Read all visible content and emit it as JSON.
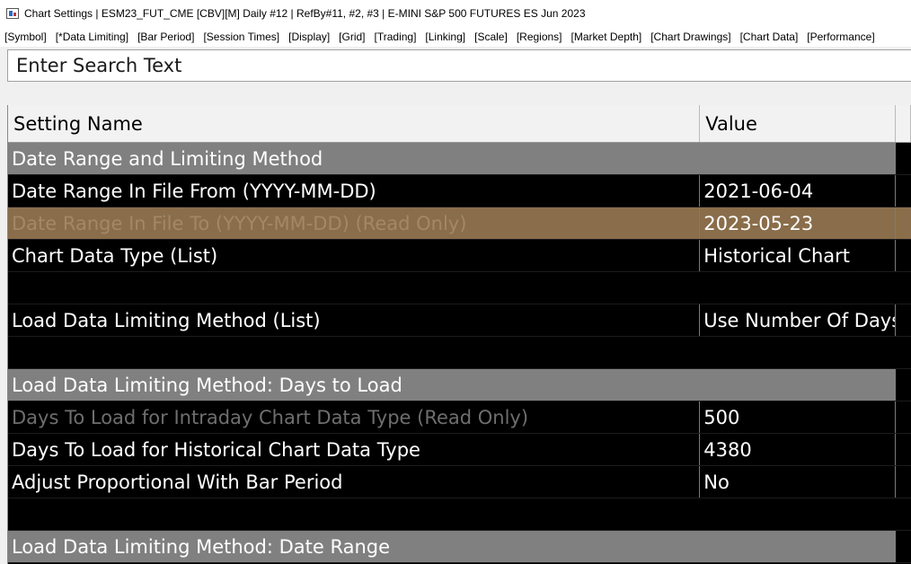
{
  "window": {
    "title": "Chart Settings | ESM23_FUT_CME [CBV][M]  Daily  #12 | RefBy#11, #2, #3 | E-MINI S&P 500 FUTURES ES Jun 2023"
  },
  "tabs": [
    "[Symbol]",
    "[*Data Limiting]",
    "[Bar Period]",
    "[Session Times]",
    "[Display]",
    "[Grid]",
    "[Trading]",
    "[Linking]",
    "[Scale]",
    "[Regions]",
    "[Market Depth]",
    "[Chart Drawings]",
    "[Chart Data]",
    "[Performance]"
  ],
  "search": {
    "placeholder": "Enter Search Text",
    "value": ""
  },
  "grid": {
    "headers": {
      "name": "Setting Name",
      "value": "Value"
    },
    "rows": [
      {
        "type": "section",
        "name": "Date Range and Limiting Method",
        "value": ""
      },
      {
        "type": "setting",
        "name": "Date Range In File From (YYYY-MM-DD)",
        "value": "2021-06-04"
      },
      {
        "type": "selected",
        "name": "Date Range In File To (YYYY-MM-DD) (Read Only)",
        "value": "2023-05-23"
      },
      {
        "type": "setting",
        "name": "Chart Data Type (List)",
        "value": "Historical Chart"
      },
      {
        "type": "blank",
        "name": "",
        "value": ""
      },
      {
        "type": "setting",
        "name": "Load Data Limiting Method (List)",
        "value": "Use Number Of Days to Load"
      },
      {
        "type": "blank",
        "name": "",
        "value": ""
      },
      {
        "type": "section",
        "name": "Load Data Limiting Method: Days to Load",
        "value": ""
      },
      {
        "type": "readonly",
        "name": "Days To Load for Intraday Chart Data Type (Read Only)",
        "value": "500"
      },
      {
        "type": "setting",
        "name": "Days To Load for Historical Chart Data Type",
        "value": "4380"
      },
      {
        "type": "setting",
        "name": "Adjust Proportional With Bar Period",
        "value": "No"
      },
      {
        "type": "blank",
        "name": "",
        "value": ""
      },
      {
        "type": "section",
        "name": "Load Data Limiting Method: Date Range",
        "value": ""
      }
    ]
  },
  "colors": {
    "section_bg": "#808080",
    "selected_bg": "#8a6d4a",
    "row_bg": "#000000",
    "readonly_text": "#6e6e6e"
  }
}
